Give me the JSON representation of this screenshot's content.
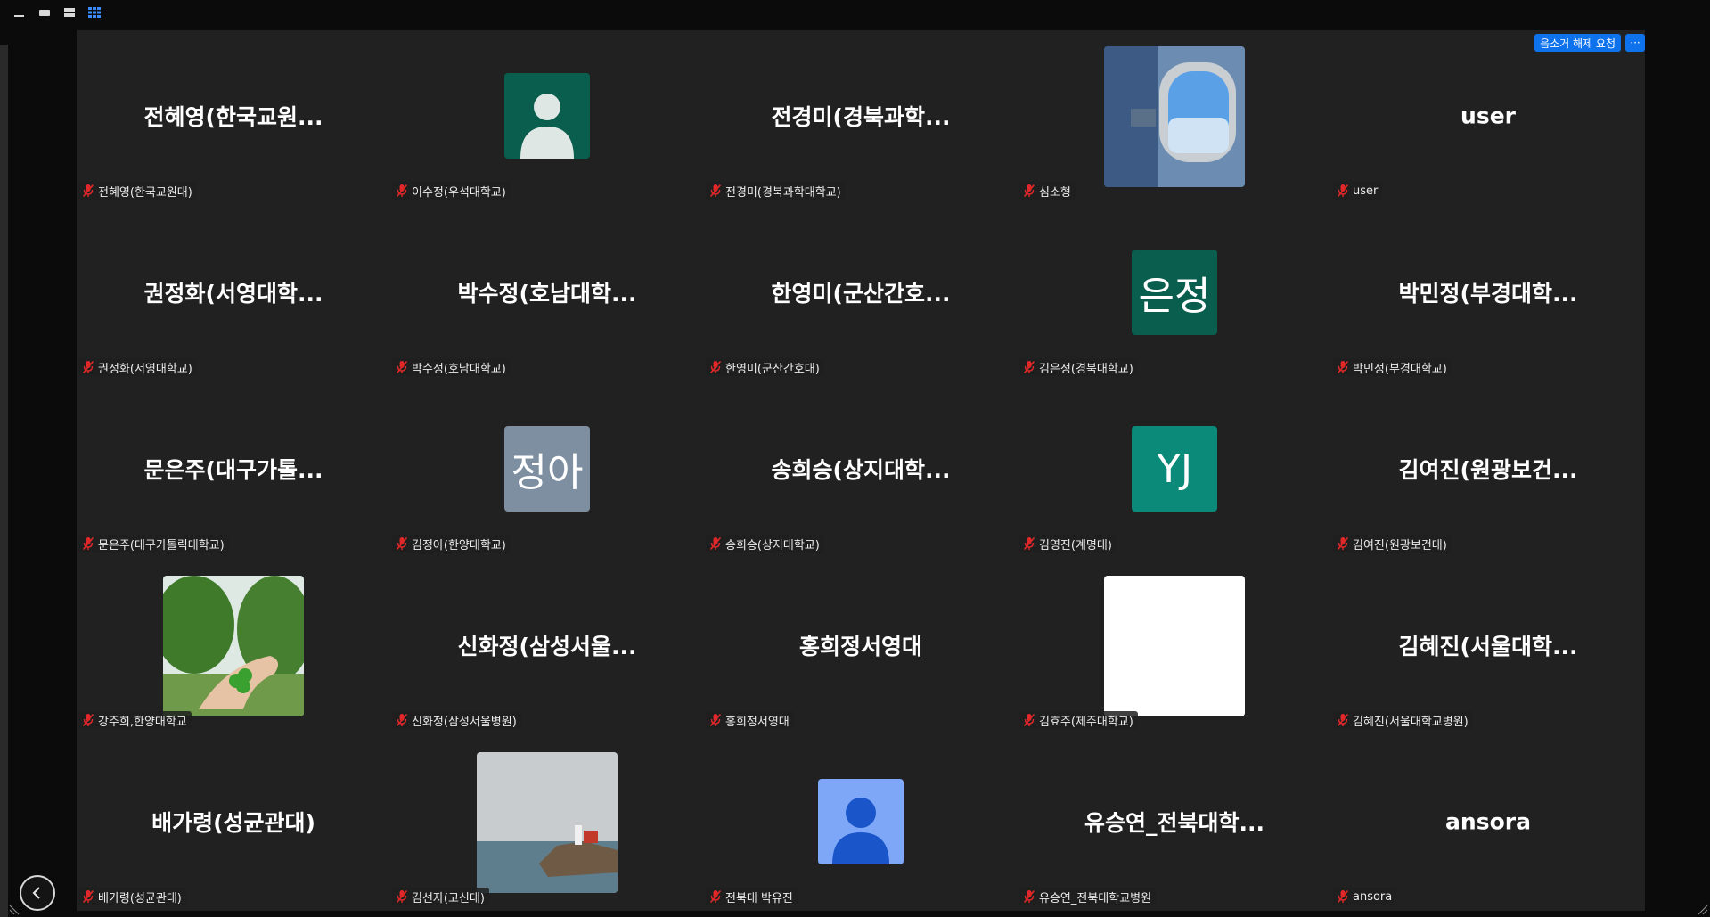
{
  "view_controls": [
    {
      "name": "minimize",
      "icon": "minimize-icon"
    },
    {
      "name": "speaker-view",
      "icon": "speaker-view-icon"
    },
    {
      "name": "stacked-view",
      "icon": "stacked-view-icon"
    },
    {
      "name": "gallery-view",
      "icon": "gallery-view-icon",
      "active": true
    }
  ],
  "toolbar": {
    "unmute_request_label": "음소거 해제 요청",
    "more_label": "···"
  },
  "participants": [
    {
      "display": "전혜영(한국교원...",
      "name": "전혜영(한국교원대)"
    },
    {
      "display": "",
      "name": "이수정(우석대학교)",
      "avatar": "person-icon-teal"
    },
    {
      "display": "전경미(경북과학...",
      "name": "전경미(경북과학대학교)"
    },
    {
      "display": "",
      "name": "심소형",
      "avatar": "airplane-window-photo"
    },
    {
      "display": "user",
      "name": "user"
    },
    {
      "display": "권정화(서영대학...",
      "name": "권정화(서영대학교)"
    },
    {
      "display": "박수정(호남대학...",
      "name": "박수정(호남대학교)"
    },
    {
      "display": "한영미(군산간호...",
      "name": "한영미(군산간호대)"
    },
    {
      "display": "",
      "name": "김은정(경북대학교)",
      "avatar_text": "은정",
      "avatar_color": "#0a5e4e"
    },
    {
      "display": "박민정(부경대학...",
      "name": "박민정(부경대학교)"
    },
    {
      "display": "문은주(대구가톨...",
      "name": "문은주(대구가톨릭대학교)"
    },
    {
      "display": "",
      "name": "김정아(한양대학교)",
      "avatar_text": "정아",
      "avatar_color": "#7d8fa0"
    },
    {
      "display": "송희승(상지대학...",
      "name": "송희승(상지대학교)"
    },
    {
      "display": "",
      "name": "김영진(계명대)",
      "avatar_text": "YJ",
      "avatar_color": "#0b8a7a"
    },
    {
      "display": "김여진(원광보건...",
      "name": "김여진(원광보건대)"
    },
    {
      "display": "",
      "name": "강주희,한양대학교",
      "avatar": "clover-hand-photo"
    },
    {
      "display": "신화정(삼성서울...",
      "name": "신화정(삼성서울병원)"
    },
    {
      "display": "홍희정서영대",
      "name": "홍희정서영대"
    },
    {
      "display": "",
      "name": "김효주(제주대학교)",
      "avatar": "blank-white-photo"
    },
    {
      "display": "김혜진(서울대학...",
      "name": "김혜진(서울대학교병원)"
    },
    {
      "display": "배가령(성균관대)",
      "name": "배가령(성균관대)"
    },
    {
      "display": "",
      "name": "김선자(고신대)",
      "avatar": "lighthouse-photo"
    },
    {
      "display": "",
      "name": "전북대 박유진",
      "avatar": "person-icon-blue"
    },
    {
      "display": "유승연_전북대학...",
      "name": "유승연_전북대학교병원"
    },
    {
      "display": "ansora",
      "name": "ansora"
    }
  ],
  "colors": {
    "accent": "#0e72ed",
    "stage_bg": "#212121",
    "muted_mic": "#e02828"
  }
}
